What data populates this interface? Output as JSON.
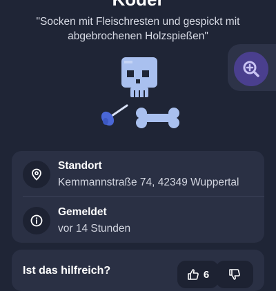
{
  "header": {
    "title": "Köder",
    "quote": "\"Socken mit Fleischresten und gespickt mit abgebrochenen Holzspießen\""
  },
  "details": {
    "location": {
      "label": "Standort",
      "value": "Kemmannstraße 74, 42349 Wuppertal",
      "icon": "map-pin-icon"
    },
    "reported": {
      "label": "Gemeldet",
      "value": "vor 14 Stunden",
      "icon": "info-icon"
    }
  },
  "feedback": {
    "question": "Ist das hilfreich?",
    "upvotes": "6"
  },
  "colors": {
    "background": "#1f2536",
    "card": "#2a3044",
    "accent": "#4a3f8e",
    "illustration": "#a9c0ef"
  }
}
